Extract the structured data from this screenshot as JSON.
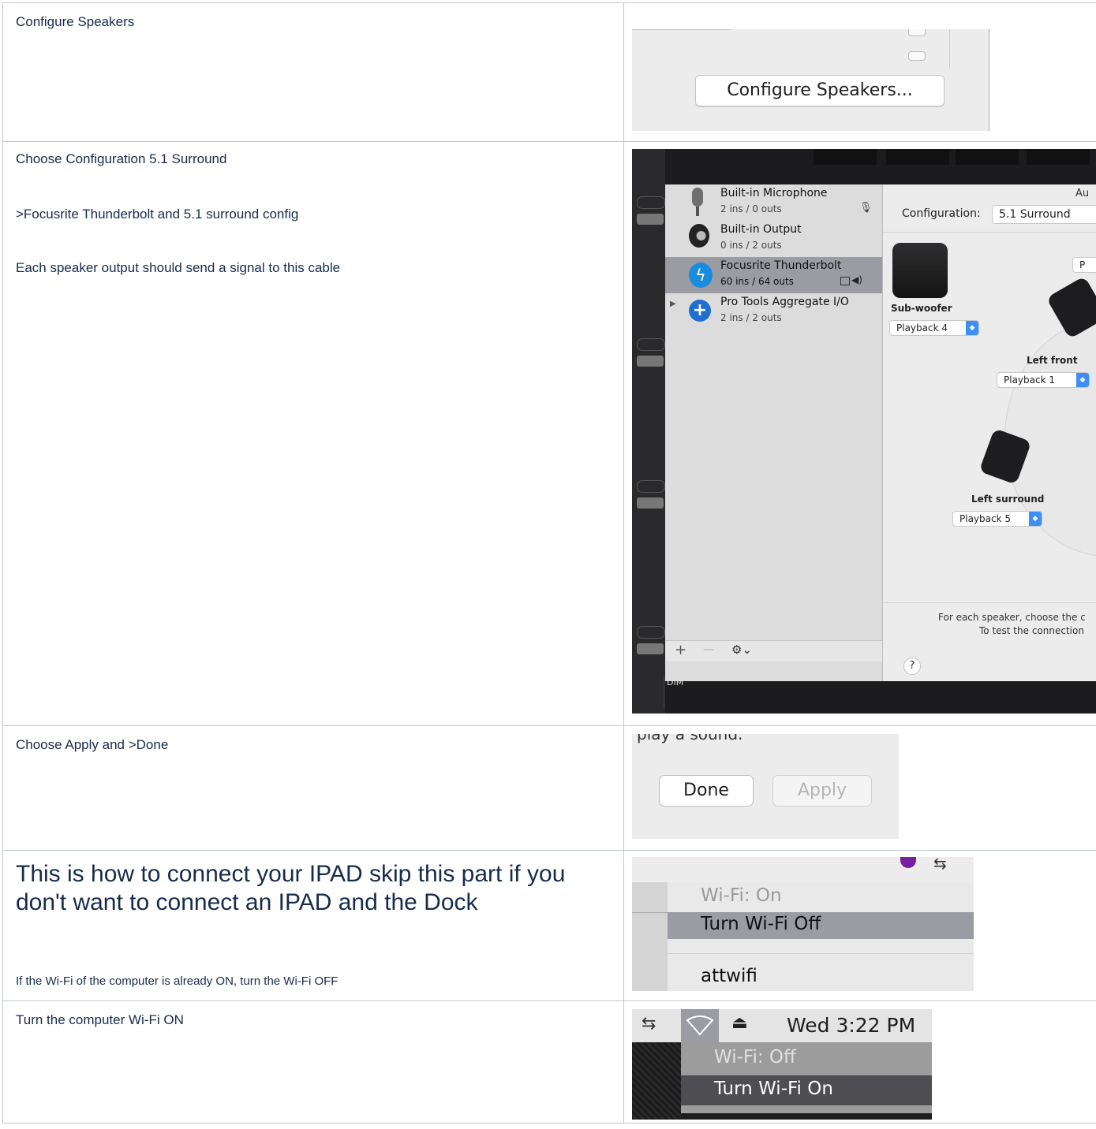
{
  "rows": [
    {
      "texts": [
        "Configure Speakers"
      ],
      "shot": {
        "button_label": "Configure Speakers..."
      }
    },
    {
      "texts": [
        "Choose Configuration 5.1 Surround",
        ">Focusrite Thunderbolt and 5.1 surround config",
        "Each speaker output should send a signal to this cable"
      ],
      "shot": {
        "window_title_fragment": "Au",
        "devices": [
          {
            "name": "Built-in Microphone",
            "io": "2 ins / 0 outs",
            "icon": "microphone-icon"
          },
          {
            "name": "Built-in Output",
            "io": "0 ins / 2 outs",
            "icon": "speaker-icon"
          },
          {
            "name": "Focusrite Thunderbolt",
            "io": "60 ins / 64 outs",
            "icon": "thunderbolt-icon",
            "selected": true
          },
          {
            "name": "Pro Tools Aggregate I/O",
            "io": "2 ins / 2 outs",
            "icon": "aggregate-plus-icon"
          }
        ],
        "configuration_label": "Configuration:",
        "configuration_value": "5.1 Surround",
        "partial_popup": "P",
        "speakers": [
          {
            "label": "Sub-woofer",
            "value": "Playback 4"
          },
          {
            "label": "Left front",
            "value": "Playback 1"
          },
          {
            "label": "Left surround",
            "value": "Playback 5"
          }
        ],
        "footer_line1": "For each speaker, choose the c",
        "footer_line2": "To test the connection",
        "help_label": "?",
        "toolbar": {
          "add": "+",
          "remove": "—",
          "gear": "⚙⌄"
        },
        "dim_label": "DIM"
      }
    },
    {
      "texts": [
        "Choose Apply and >Done"
      ],
      "shot": {
        "top_fragment": "play a sound.",
        "done_label": "Done",
        "apply_label": "Apply"
      }
    },
    {
      "texts": [
        "This is how to connect your IPAD skip this part if you don't want to connect an IPAD and the Dock",
        "If the Wi-Fi of the computer is already ON, turn the Wi-Fi OFF"
      ],
      "shot": {
        "status": "Wi-Fi: On",
        "action": "Turn Wi-Fi Off",
        "network": "attwifi"
      }
    },
    {
      "texts": [
        "Turn the computer Wi-Fi ON"
      ],
      "shot": {
        "clock": "Wed 3:22 PM",
        "status": "Wi-Fi: Off",
        "action": "Turn Wi-Fi On"
      }
    }
  ],
  "colors": {
    "selection": "#9b9ba3",
    "accent_blue": "#3d8ef7",
    "border": "#c1c7d0",
    "text": "#172b4d"
  }
}
